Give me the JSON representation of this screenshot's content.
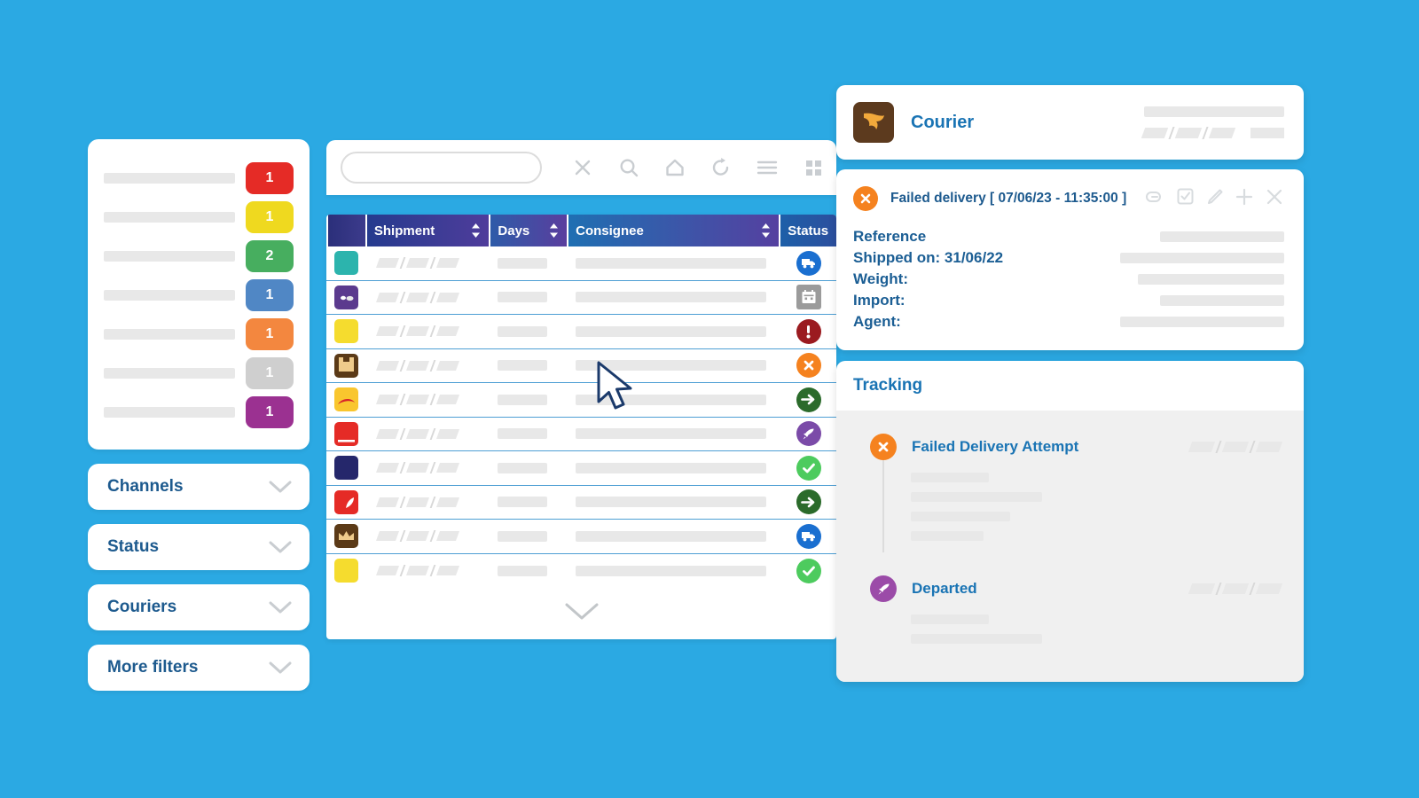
{
  "theme": {
    "background": "#2BA9E3",
    "accent_blue": "#1A74B4",
    "label_blue": "#1B5E94",
    "orange": "#F5821F"
  },
  "sidebar": {
    "counts_card": {
      "rows": [
        {
          "label_placeholder": "",
          "count": "1",
          "color": "#E52B26"
        },
        {
          "label_placeholder": "",
          "count": "1",
          "color": "#EFD91F"
        },
        {
          "label_placeholder": "",
          "count": "2",
          "color": "#47AE5F"
        },
        {
          "label_placeholder": "",
          "count": "1",
          "color": "#5087C5"
        },
        {
          "label_placeholder": "",
          "count": "1",
          "color": "#F3873F"
        },
        {
          "label_placeholder": "",
          "count": "1",
          "color": "#CFCFCF"
        },
        {
          "label_placeholder": "",
          "count": "1",
          "color": "#9B3191"
        }
      ]
    },
    "filters": [
      {
        "label": "Channels",
        "icon": "chevron-down-icon"
      },
      {
        "label": "Status",
        "icon": "chevron-down-icon"
      },
      {
        "label": "Couriers",
        "icon": "chevron-down-icon"
      },
      {
        "label": "More filters",
        "icon": "chevron-down-icon"
      }
    ]
  },
  "toolbar": {
    "search_value": "",
    "search_placeholder": "",
    "icons": [
      {
        "name": "close-icon"
      },
      {
        "name": "search-icon"
      },
      {
        "name": "home-icon"
      },
      {
        "name": "refresh-icon"
      },
      {
        "name": "list-view-icon"
      },
      {
        "name": "grid-view-icon"
      }
    ]
  },
  "table": {
    "columns": [
      {
        "label": "",
        "sortable": false
      },
      {
        "label": "Shipment",
        "sortable": true
      },
      {
        "label": "Days",
        "sortable": true
      },
      {
        "label": "Consignee",
        "sortable": true
      },
      {
        "label": "Status",
        "sortable": false
      }
    ],
    "rows": [
      {
        "carrier_color": "#2CB4AD",
        "carrier_mark": "plain",
        "status_icon": "truck-icon",
        "status_color": "#1A6FD0",
        "status_shape": "circle"
      },
      {
        "carrier_color": "#5B3A8E",
        "carrier_mark": "eyes",
        "status_icon": "calendar-icon",
        "status_color": "#9B9B9B",
        "status_shape": "square"
      },
      {
        "carrier_color": "#F5DC2E",
        "carrier_mark": "plain",
        "status_icon": "exclamation-icon",
        "status_color": "#9B1B20",
        "status_shape": "circle"
      },
      {
        "carrier_color": "#5B3A17",
        "carrier_mark": "box",
        "status_icon": "close-icon",
        "status_color": "#F5821F",
        "status_shape": "circle"
      },
      {
        "carrier_color": "#F9C62E",
        "carrier_mark": "swoosh",
        "status_icon": "arrow-right-icon",
        "status_color": "#2B6B2B",
        "status_shape": "circle"
      },
      {
        "carrier_color": "#E52B26",
        "carrier_mark": "bar",
        "status_icon": "rocket-icon",
        "status_color": "#7B4BA8",
        "status_shape": "circle"
      },
      {
        "carrier_color": "#25276B",
        "carrier_mark": "plain",
        "status_icon": "check-icon",
        "status_color": "#4DCB5E",
        "status_shape": "circle"
      },
      {
        "carrier_color": "#E52B26",
        "carrier_mark": "wing",
        "status_icon": "arrow-right-icon",
        "status_color": "#2B6B2B",
        "status_shape": "circle"
      },
      {
        "carrier_color": "#5B3A17",
        "carrier_mark": "crown",
        "status_icon": "truck-icon",
        "status_color": "#1A6FD0",
        "status_shape": "circle"
      },
      {
        "carrier_color": "#F5DC2E",
        "carrier_mark": "plain",
        "status_icon": "check-icon",
        "status_color": "#4DCB5E",
        "status_shape": "circle"
      }
    ],
    "footer_icon": "chevron-down-icon"
  },
  "detail": {
    "courier": {
      "label": "Courier",
      "logo_icon": "courier-logo-icon",
      "logo_bg": "#5C3A1E"
    },
    "event": {
      "status_icon": "close-icon",
      "title": "Failed delivery [ 07/06/23 - 11:35:00 ]",
      "actions": [
        {
          "name": "link-icon"
        },
        {
          "name": "checkbox-icon"
        },
        {
          "name": "edit-pencil-icon"
        },
        {
          "name": "plus-icon"
        },
        {
          "name": "close-icon"
        }
      ],
      "fields": [
        {
          "label": "Reference"
        },
        {
          "label": "Shipped on: 31/06/22"
        },
        {
          "label": "Weight:"
        },
        {
          "label": "Import:"
        },
        {
          "label": "Agent:"
        }
      ]
    },
    "tracking": {
      "title": "Tracking",
      "events": [
        {
          "name": "Failed Delivery Attempt",
          "icon": "close-icon",
          "icon_color": "#F5821F",
          "detail_line_count": 4
        },
        {
          "name": "Departed",
          "icon": "rocket-icon",
          "icon_color": "#9B4BA8",
          "detail_line_count": 2
        }
      ]
    }
  },
  "cursor": {
    "name": "mouse-pointer-icon"
  }
}
